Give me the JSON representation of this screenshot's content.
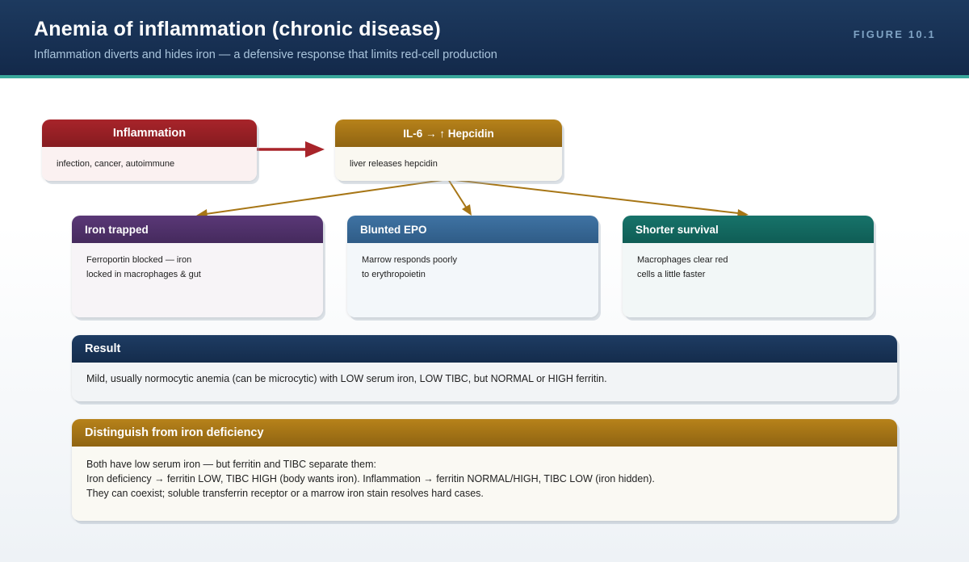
{
  "header": {
    "title": "Anemia of inflammation (chronic disease)",
    "subtitle": "Inflammation diverts and hides iron — a defensive response that limits red-cell production",
    "figure_tag": "FIGURE 10.1"
  },
  "colors": {
    "header_bg": "#13294a",
    "accent_rule": "#3aa89b",
    "inflammation": "#9c2126",
    "hepcidin": "#a77616",
    "iron_trapped": "#4f3169",
    "blunted_epo": "#366795",
    "shorter_survival": "#136a61",
    "result": "#19345a"
  },
  "nodes": {
    "inflammation": {
      "title": "Inflammation",
      "body": "infection, cancer, autoimmune"
    },
    "hepcidin": {
      "title": "IL-6 → ↑ Hepcidin",
      "body": "liver releases hepcidin"
    },
    "iron_trapped": {
      "title": "Iron trapped",
      "lines": [
        "Ferroportin blocked — iron",
        "locked in macrophages & gut"
      ]
    },
    "blunted_epo": {
      "title": "Blunted EPO",
      "lines": [
        "Marrow responds poorly",
        "to erythropoietin"
      ]
    },
    "shorter_survival": {
      "title": "Shorter survival",
      "lines": [
        "Macrophages clear red",
        "cells a little faster"
      ]
    }
  },
  "result": {
    "title": "Result",
    "body": "Mild, usually normocytic anemia (can be microcytic) with LOW serum iron, LOW TIBC, but NORMAL or HIGH ferritin."
  },
  "distinguish": {
    "title": "Distinguish from iron deficiency",
    "lines": [
      "Both have low serum iron — but ferritin and TIBC separate them:",
      "Iron deficiency → ferritin LOW, TIBC HIGH (body wants iron). Inflammation → ferritin NORMAL/HIGH, TIBC LOW (iron hidden).",
      "They can coexist; soluble transferrin receptor or a marrow iron stain resolves hard cases."
    ]
  }
}
